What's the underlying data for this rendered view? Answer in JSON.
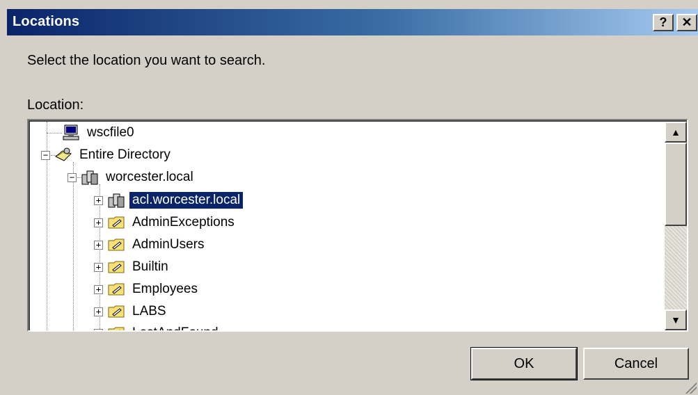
{
  "dialog": {
    "title": "Locations",
    "help_label": "?",
    "close_label": "✕",
    "prompt": "Select the location you want to search.",
    "location_label": "Location:"
  },
  "tree": {
    "items": [
      {
        "label": "wscfile0",
        "icon": "computer-icon",
        "expander": ""
      },
      {
        "label": "Entire Directory",
        "icon": "directory-icon",
        "expander": "−"
      },
      {
        "label": "worcester.local",
        "icon": "domain-icon",
        "expander": "−"
      },
      {
        "label": "acl.worcester.local",
        "icon": "domain-icon",
        "expander": "+",
        "selected": true
      },
      {
        "label": "AdminExceptions",
        "icon": "ou-folder-icon",
        "expander": "+"
      },
      {
        "label": "AdminUsers",
        "icon": "ou-folder-icon",
        "expander": "+"
      },
      {
        "label": "Builtin",
        "icon": "ou-folder-icon",
        "expander": "+"
      },
      {
        "label": "Employees",
        "icon": "ou-folder-icon",
        "expander": "+"
      },
      {
        "label": "LABS",
        "icon": "ou-folder-icon",
        "expander": "+"
      },
      {
        "label": "LostAndFound",
        "icon": "ou-folder-icon",
        "expander": "+"
      }
    ]
  },
  "scrollbar": {
    "up": "▲",
    "down": "▼"
  },
  "buttons": {
    "ok": "OK",
    "cancel": "Cancel"
  },
  "colors": {
    "title_start": "#0a246a",
    "title_end": "#a6caf0",
    "selection": "#0a246a",
    "face": "#d4d0c8"
  }
}
